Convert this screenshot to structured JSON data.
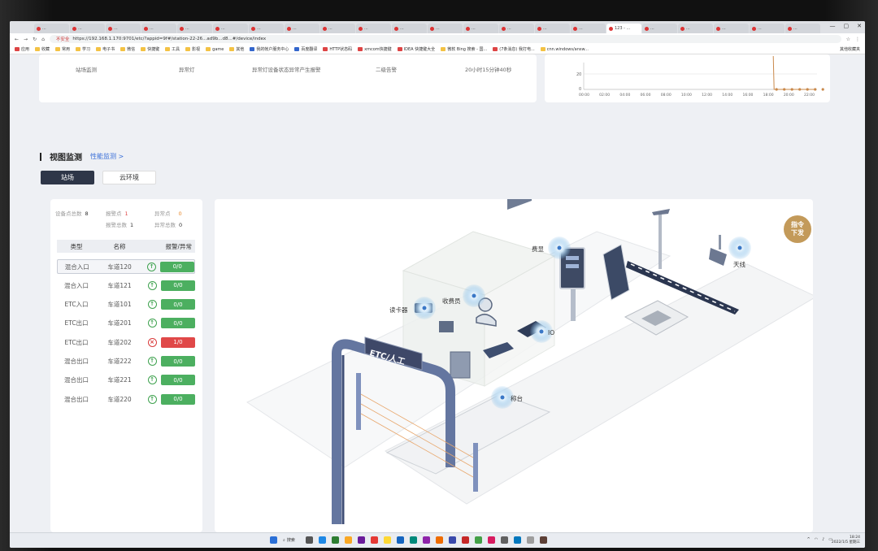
{
  "browser": {
    "tabs": [
      "...",
      "...",
      "...",
      "...",
      "...",
      "...",
      "...",
      "...",
      "...",
      "...",
      "...",
      "...",
      "...",
      "...",
      "...",
      "...",
      "123 - ...",
      "...",
      "...",
      "...",
      "...",
      "..."
    ],
    "active_tab_index": 16,
    "url_warning": "不安全",
    "url": "https://192.168.1.170:9701/etc/?appid=9f#/station-22-26...ad9b...d8...#/device/index",
    "bookmarks": [
      "应用",
      "收藏",
      "常用",
      "学习",
      "电子书",
      "微信",
      "快捷键",
      "工具",
      "影视",
      "game",
      "其他",
      "我的帐户服务中心",
      "百度翻译",
      "HTTP状态码",
      "xmcom快捷键",
      "IDEA 快捷键大全",
      "微软 Bing 搜索 - 国...",
      "(7条消息) 我打电...",
      "cnn.windows/answ..."
    ],
    "side_bookmark": "其他收藏夹"
  },
  "top_card": {
    "legend": [
      "站场监测",
      "异常灯",
      "异常灯设备状态异常产生报警",
      "二级告警",
      "20小时15分钟40秒"
    ]
  },
  "mini_chart": {
    "y_ticks": [
      "20",
      "0"
    ],
    "x_ticks": [
      "00:00",
      "02:00",
      "04:00",
      "06:00",
      "08:00",
      "10:00",
      "12:00",
      "14:00",
      "16:00",
      "18:00",
      "20:00",
      "22:00"
    ]
  },
  "section": {
    "title": "视图监测",
    "link": "性能监测 >"
  },
  "view_tabs": {
    "active": "站场",
    "inactive": "云环境"
  },
  "stats": {
    "device_total_label": "设备点总数",
    "device_total": "8",
    "alarm_point_label": "报警点",
    "alarm_point": "1",
    "abnormal_point_label": "异常点",
    "abnormal_point": "0",
    "alarm_total_label": "报警总数",
    "alarm_total": "1",
    "abnormal_total_label": "异常总数",
    "abnormal_total": "0"
  },
  "table": {
    "headers": [
      "类型",
      "名称",
      "报警/异常"
    ],
    "rows": [
      {
        "type": "混合入口",
        "name": "车道120",
        "status": "ok",
        "value": "0/0"
      },
      {
        "type": "混合入口",
        "name": "车道121",
        "status": "ok",
        "value": "0/0"
      },
      {
        "type": "ETC入口",
        "name": "车道101",
        "status": "ok",
        "value": "0/0"
      },
      {
        "type": "ETC出口",
        "name": "车道201",
        "status": "ok",
        "value": "0/0"
      },
      {
        "type": "ETC出口",
        "name": "车道202",
        "status": "err",
        "value": "1/0"
      },
      {
        "type": "混合出口",
        "name": "车道222",
        "status": "ok",
        "value": "0/0"
      },
      {
        "type": "混合出口",
        "name": "车道221",
        "status": "ok",
        "value": "0/0"
      },
      {
        "type": "混合出口",
        "name": "车道220",
        "status": "ok",
        "value": "0/0"
      }
    ]
  },
  "scene": {
    "command_button": "指令下发",
    "gantry_sign": "ETC/人工",
    "labels": {
      "card_reader": "读卡器",
      "toll_booth": "收费员",
      "fee_display": "费显",
      "io": "IO",
      "antenna": "天线",
      "weigh_platform": "称台"
    }
  },
  "colors": {
    "ok": "#4caf60",
    "error": "#e04848",
    "command": "#c39a5a",
    "active_tab": "#2e3648",
    "link": "#3a6fd8"
  },
  "taskbar": {
    "search": "搜索",
    "clock_time": "18:24",
    "clock_date": "2022/1/5 星期三"
  }
}
